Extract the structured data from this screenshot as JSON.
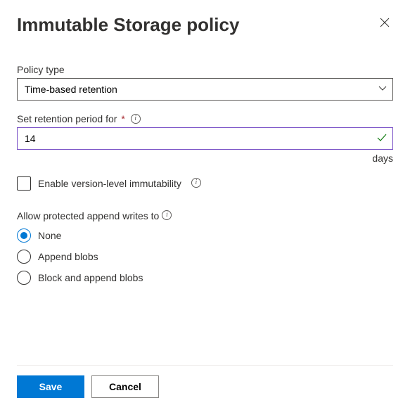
{
  "header": {
    "title": "Immutable Storage policy"
  },
  "policyType": {
    "label": "Policy type",
    "value": "Time-based retention"
  },
  "retention": {
    "label": "Set retention period for",
    "required": "*",
    "value": "14",
    "unit": "days"
  },
  "versionLevel": {
    "label": "Enable version-level immutability",
    "checked": false
  },
  "appendWrites": {
    "label": "Allow protected append writes to",
    "selected": "none",
    "options": {
      "none": "None",
      "append": "Append blobs",
      "block": "Block and append blobs"
    }
  },
  "footer": {
    "save": "Save",
    "cancel": "Cancel"
  }
}
